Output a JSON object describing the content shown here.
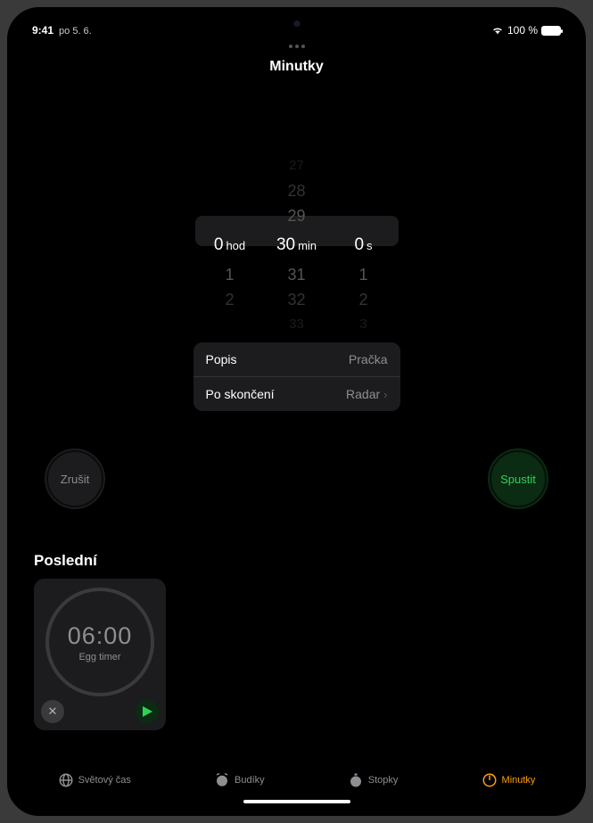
{
  "status": {
    "time": "9:41",
    "date": "po 5. 6.",
    "battery_pct": "100 %"
  },
  "header": {
    "title": "Minutky"
  },
  "picker": {
    "hour": {
      "value": "0",
      "unit": "hod",
      "below": [
        "1",
        "2"
      ]
    },
    "minute": {
      "value": "30",
      "unit": "min",
      "above": [
        "27",
        "28",
        "29"
      ],
      "below": [
        "31",
        "32",
        "33"
      ]
    },
    "second": {
      "value": "0",
      "unit": "s",
      "below": [
        "1",
        "2",
        "3"
      ]
    }
  },
  "settings": {
    "label_row": {
      "label": "Popis",
      "value": "Pračka"
    },
    "sound_row": {
      "label": "Po skončení",
      "value": "Radar"
    }
  },
  "actions": {
    "cancel": "Zrušit",
    "start": "Spustit"
  },
  "recents": {
    "title": "Poslední",
    "items": [
      {
        "time": "06:00",
        "label": "Egg timer"
      }
    ]
  },
  "tabs": {
    "world": "Světový čas",
    "alarm": "Budíky",
    "stop": "Stopky",
    "timer": "Minutky"
  }
}
